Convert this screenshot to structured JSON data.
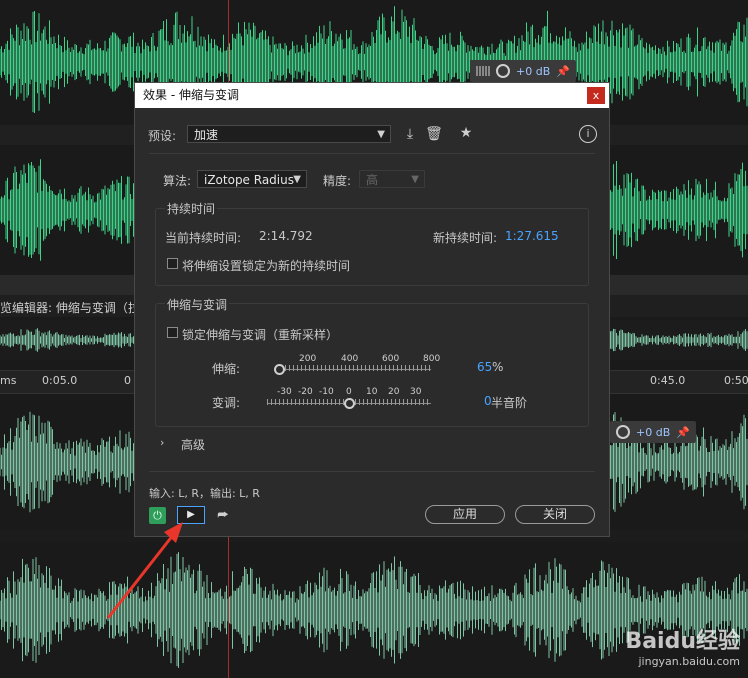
{
  "dialog": {
    "title": "效果 - 伸缩与变调",
    "close_glyph": "x",
    "preset_label": "预设:",
    "preset_value": "加速",
    "algorithm_label": "算法:",
    "algorithm_value": "iZotope Radius",
    "precision_label": "精度:",
    "precision_value": "高",
    "duration_group": {
      "title": "持续时间",
      "current_label": "当前持续时间:",
      "current_value": "2:14.792",
      "new_label": "新持续时间:",
      "new_value": "1:27.615",
      "lock_label": "将伸缩设置锁定为新的持续时间"
    },
    "stretch_group": {
      "title": "伸缩与变调",
      "lock_label": "锁定伸缩与变调（重新采样）",
      "stretch_label": "伸缩:",
      "stretch_scale": [
        "200",
        "400",
        "600",
        "800"
      ],
      "stretch_value": "65",
      "stretch_unit": "%",
      "stretch_fraction": 0.0,
      "pitch_label": "变调:",
      "pitch_scale": [
        "-30",
        "-20",
        "-10",
        "0",
        "10",
        "20",
        "30"
      ],
      "pitch_value": "0",
      "pitch_unit": "半音阶",
      "pitch_fraction": 0.5
    },
    "advanced_label": "高级",
    "io_text": "输入: L, R，输出: L, R",
    "apply_label": "应用",
    "close_label": "关闭"
  },
  "background": {
    "editor_title": "览编辑器: 伸缩与变调（拉",
    "ruler_labels": [
      "ms",
      "0:05.0",
      "0",
      "0:45.0",
      "0:50"
    ],
    "volume_top": "+0 dB",
    "volume_bottom": "+0 dB"
  },
  "watermark": {
    "brand": "Baidu经验",
    "url": "jingyan.baidu.com"
  },
  "colors": {
    "wave_top": "#3fd38a",
    "wave_bottom": "#7fc4a4",
    "accent": "#4aa3ff",
    "close_red": "#c42b1c",
    "power_green": "#2f9e5b",
    "annotation_arrow": "#e8362b"
  }
}
